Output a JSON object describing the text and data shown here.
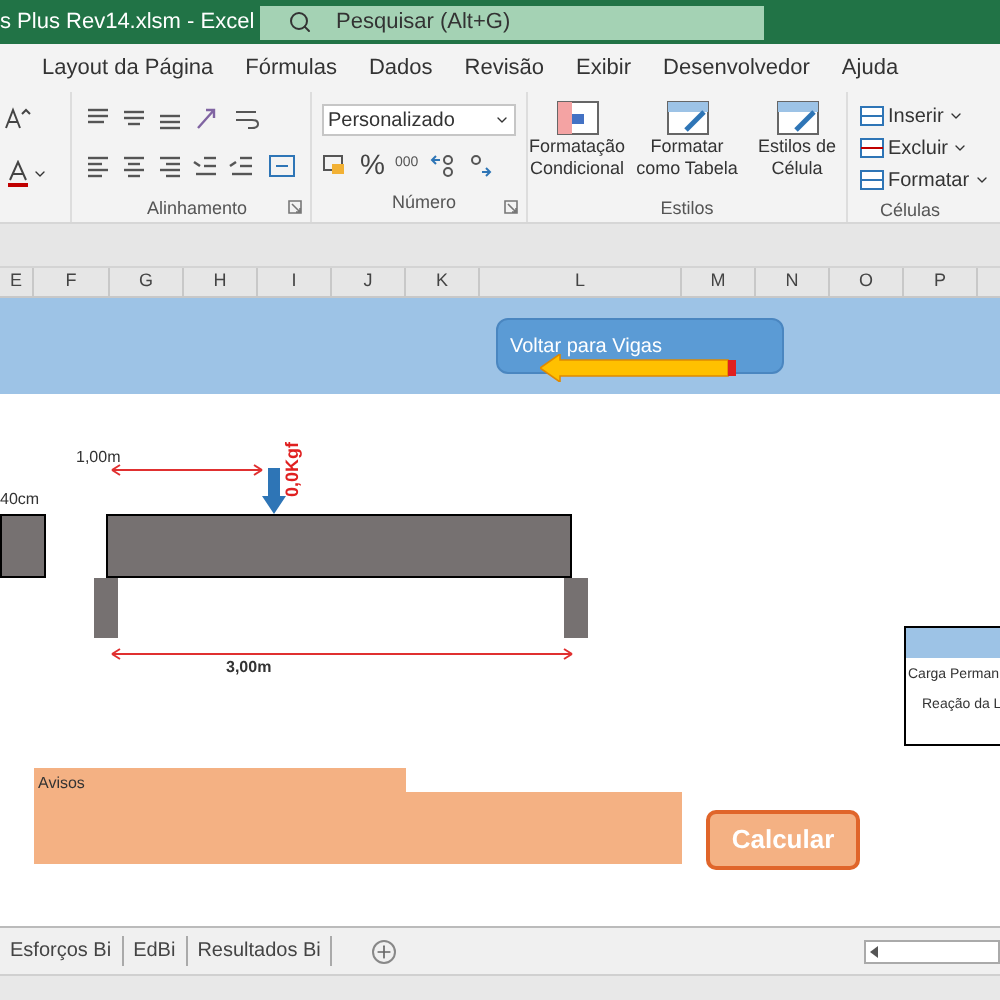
{
  "title_bar": {
    "title": "s Plus Rev14.xlsm  -  Excel",
    "search": {
      "placeholder": "Pesquisar (Alt+G)"
    }
  },
  "menu": [
    {
      "label": "Layout da Página",
      "selected": false
    },
    {
      "label": "Fórmulas",
      "selected": false
    },
    {
      "label": "Dados",
      "selected": false
    },
    {
      "label": "Revisão",
      "selected": false
    },
    {
      "label": "Exibir",
      "selected": false
    },
    {
      "label": "Desenvolvedor",
      "selected": false
    },
    {
      "label": "Ajuda",
      "selected": false
    }
  ],
  "ribbon": {
    "alignment": {
      "label": "Alinhamento"
    },
    "number": {
      "format": "Personalizado",
      "percent": "%",
      "thousands": "000",
      "label": "Número"
    },
    "styles": {
      "buttons": [
        "Formatação Condicional",
        "Formatar como Tabela",
        "Estilos de Célula"
      ],
      "label": "Estilos"
    },
    "cells": {
      "buttons": [
        "Inserir",
        "Excluir",
        "Formatar"
      ],
      "label": "Células"
    }
  },
  "columns": [
    "E",
    "F",
    "G",
    "H",
    "I",
    "J",
    "K",
    "L",
    "M",
    "N",
    "O",
    "P"
  ],
  "sheet": {
    "back_button": "Voltar para Vigas",
    "drawing": {
      "width_label": "40cm",
      "load_position": "1,00m",
      "load": "0,0Kgf",
      "span": "3,00m"
    },
    "table": [
      "Carga Perman",
      "Reação da L"
    ],
    "warnings": {
      "label": "Avisos"
    },
    "calculate_button": "Calcular"
  },
  "sheet_tabs": [
    {
      "label": "Esforços Bi",
      "selected": false
    },
    {
      "label": "EdBi",
      "selected": false
    },
    {
      "label": "Resultados Bi",
      "selected": false
    }
  ]
}
